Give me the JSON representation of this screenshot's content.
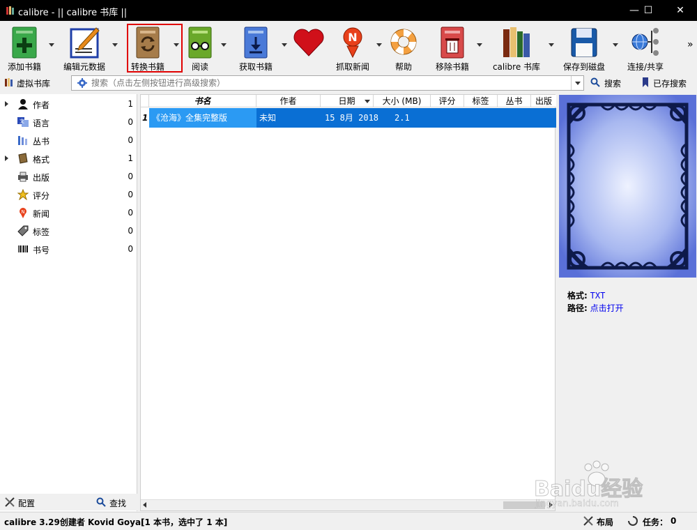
{
  "window": {
    "title": "calibre - || calibre 书库 ||",
    "min": "—",
    "max": "☐",
    "close": "✕"
  },
  "toolbar": {
    "add": "添加书籍",
    "edit": "编辑元数据",
    "convert": "转换书籍",
    "read": "阅读",
    "fetch": "获取书籍",
    "news": "抓取新闻",
    "help": "帮助",
    "remove": "移除书籍",
    "library": "calibre 书库",
    "save": "保存到磁盘",
    "share": "连接/共享",
    "more": "»"
  },
  "searchbar": {
    "virtual_library": "虚拟书库",
    "placeholder": "搜索（点击左侧按钮进行高级搜索）",
    "search": "搜索",
    "saved": "已存搜索"
  },
  "categories": [
    {
      "name": "作者",
      "count": "1"
    },
    {
      "name": "语言",
      "count": "0"
    },
    {
      "name": "丛书",
      "count": "0"
    },
    {
      "name": "格式",
      "count": "1"
    },
    {
      "name": "出版",
      "count": "0"
    },
    {
      "name": "评分",
      "count": "0"
    },
    {
      "name": "新闻",
      "count": "0"
    },
    {
      "name": "标签",
      "count": "0"
    },
    {
      "name": "书号",
      "count": "0"
    }
  ],
  "left_bottom": {
    "config": "配置",
    "find": "查找"
  },
  "table": {
    "columns": [
      "书名",
      "作者",
      "日期",
      "大小 (MB)",
      "评分",
      "标签",
      "丛书",
      "出版"
    ],
    "rows": [
      {
        "num": "1",
        "title": "《沧海》全集完整版",
        "author": "未知",
        "date": "15 8月 2018",
        "size": "2.1"
      }
    ]
  },
  "details": {
    "format_label": "格式:",
    "format_value": "TXT",
    "path_label": "路径:",
    "path_value": "点击打开"
  },
  "status": {
    "left": "calibre 3.29创建者 Kovid Goyal",
    "books": "[1 本书，选中了 1 本]",
    "layout": "布局",
    "jobs": "任务：",
    "jobs_count": "0"
  },
  "watermark": {
    "text": "Baidu经验",
    "url": "jingyan.baidu.com"
  },
  "colors": {
    "selection": "#1e90ff",
    "highlight_border": "#e00000",
    "link": "#0000ee"
  }
}
